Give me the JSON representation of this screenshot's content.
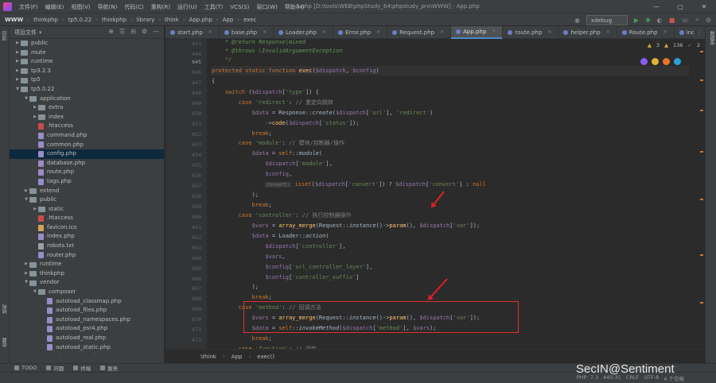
{
  "menu": [
    "文件(F)",
    "编辑(E)",
    "视图(V)",
    "导航(N)",
    "代码(C)",
    "重构(R)",
    "运行(U)",
    "工具(T)",
    "VCS(S)",
    "窗口(W)",
    "帮助(H)"
  ],
  "window_title": "1.php [D:\\tools\\WEB\\phpStudy_64\\phpstudy_pro\\WWW] - App.php",
  "win_controls": [
    "—",
    "▢",
    "✕"
  ],
  "breadcrumb": [
    "WWW",
    "thinkphp",
    "tp5.0.22",
    "thinkphp",
    "library",
    "think",
    "App.php",
    "App",
    "exec"
  ],
  "run_config": "xdebug",
  "project": {
    "title": "项目文件",
    "tree": [
      {
        "label": "public",
        "depth": 2,
        "type": "folder",
        "arrow": "▶"
      },
      {
        "label": "route",
        "depth": 2,
        "type": "folder",
        "arrow": "▶"
      },
      {
        "label": "runtime",
        "depth": 2,
        "type": "folder",
        "arrow": "▶"
      },
      {
        "label": "tp3.2.3",
        "depth": 2,
        "type": "folder",
        "arrow": "▶"
      },
      {
        "label": "tp5",
        "depth": 2,
        "type": "folder",
        "arrow": "▶"
      },
      {
        "label": "tp5.0.22",
        "depth": 2,
        "type": "folder",
        "arrow": "▼"
      },
      {
        "label": "application",
        "depth": 3,
        "type": "folder",
        "arrow": "▼"
      },
      {
        "label": "extra",
        "depth": 4,
        "type": "folder",
        "arrow": "▶"
      },
      {
        "label": "index",
        "depth": 4,
        "type": "folder",
        "arrow": "▶"
      },
      {
        "label": ".htaccess",
        "depth": 4,
        "type": "ht",
        "arrow": ""
      },
      {
        "label": "command.php",
        "depth": 4,
        "type": "file",
        "arrow": ""
      },
      {
        "label": "common.php",
        "depth": 4,
        "type": "file",
        "arrow": ""
      },
      {
        "label": "config.php",
        "depth": 4,
        "type": "file",
        "arrow": "",
        "selected": true
      },
      {
        "label": "database.php",
        "depth": 4,
        "type": "file",
        "arrow": ""
      },
      {
        "label": "route.php",
        "depth": 4,
        "type": "file",
        "arrow": ""
      },
      {
        "label": "tags.php",
        "depth": 4,
        "type": "file",
        "arrow": ""
      },
      {
        "label": "extend",
        "depth": 3,
        "type": "folder",
        "arrow": "▶"
      },
      {
        "label": "public",
        "depth": 3,
        "type": "folder",
        "arrow": "▼"
      },
      {
        "label": "static",
        "depth": 4,
        "type": "folder",
        "arrow": "▶"
      },
      {
        "label": ".htaccess",
        "depth": 4,
        "type": "ht",
        "arrow": ""
      },
      {
        "label": "favicon.ico",
        "depth": 4,
        "type": "img",
        "arrow": ""
      },
      {
        "label": "index.php",
        "depth": 4,
        "type": "file",
        "arrow": ""
      },
      {
        "label": "robots.txt",
        "depth": 4,
        "type": "txt",
        "arrow": ""
      },
      {
        "label": "router.php",
        "depth": 4,
        "type": "file",
        "arrow": ""
      },
      {
        "label": "runtime",
        "depth": 3,
        "type": "folder",
        "arrow": "▶"
      },
      {
        "label": "thinkphp",
        "depth": 3,
        "type": "folder",
        "arrow": "▶"
      },
      {
        "label": "vendor",
        "depth": 3,
        "type": "folder",
        "arrow": "▼"
      },
      {
        "label": "composer",
        "depth": 4,
        "type": "folder",
        "arrow": "▼"
      },
      {
        "label": "autoload_classmap.php",
        "depth": 5,
        "type": "file",
        "arrow": ""
      },
      {
        "label": "autoload_files.php",
        "depth": 5,
        "type": "file",
        "arrow": ""
      },
      {
        "label": "autoload_namespaces.php",
        "depth": 5,
        "type": "file",
        "arrow": ""
      },
      {
        "label": "autoload_psr4.php",
        "depth": 5,
        "type": "file",
        "arrow": ""
      },
      {
        "label": "autoload_real.php",
        "depth": 5,
        "type": "file",
        "arrow": ""
      },
      {
        "label": "autoload_static.php",
        "depth": 5,
        "type": "file",
        "arrow": ""
      },
      {
        "label": "ClassLoader.php",
        "depth": 5,
        "type": "file",
        "arrow": ""
      }
    ]
  },
  "tabs": [
    {
      "label": "start.php",
      "active": false
    },
    {
      "label": "base.php",
      "active": false
    },
    {
      "label": "Loader.php",
      "active": false
    },
    {
      "label": "Error.php",
      "active": false
    },
    {
      "label": "Request.php",
      "active": false
    },
    {
      "label": "App.php",
      "active": true
    },
    {
      "label": "route.php",
      "active": false
    },
    {
      "label": "helper.php",
      "active": false
    },
    {
      "label": "Route.php",
      "active": false
    },
    {
      "label": "index.php",
      "active": false
    }
  ],
  "inspections": {
    "warnings": "3",
    "weak": "136",
    "ok": "2"
  },
  "lines": [
    "643",
    "644",
    "645",
    "646",
    "647",
    "648",
    "649",
    "650",
    "651",
    "652",
    "653",
    "654",
    "655",
    "656",
    "657",
    "658",
    "659",
    "660",
    "661",
    "662",
    "663",
    "664",
    "665",
    "666",
    "667",
    "668",
    "669",
    "670",
    "671",
    "672"
  ],
  "current_line_index": 2,
  "param_hint": "convert:",
  "editor_breadcrumb": [
    "\\think",
    "App",
    "exec()"
  ],
  "bottom_tools": [
    "TODO",
    "问题",
    "终端",
    "服务"
  ],
  "status": {
    "php": "PHP: 7.3",
    "pos": "445:31",
    "crlf": "CRLF",
    "enc": "UTF-8",
    "indent": "4 个空格"
  },
  "watermark": "SecIN@Sentiment",
  "sidebar_left": [
    "项目",
    "结构",
    "收藏"
  ],
  "sidebar_right": [
    "数据库"
  ]
}
